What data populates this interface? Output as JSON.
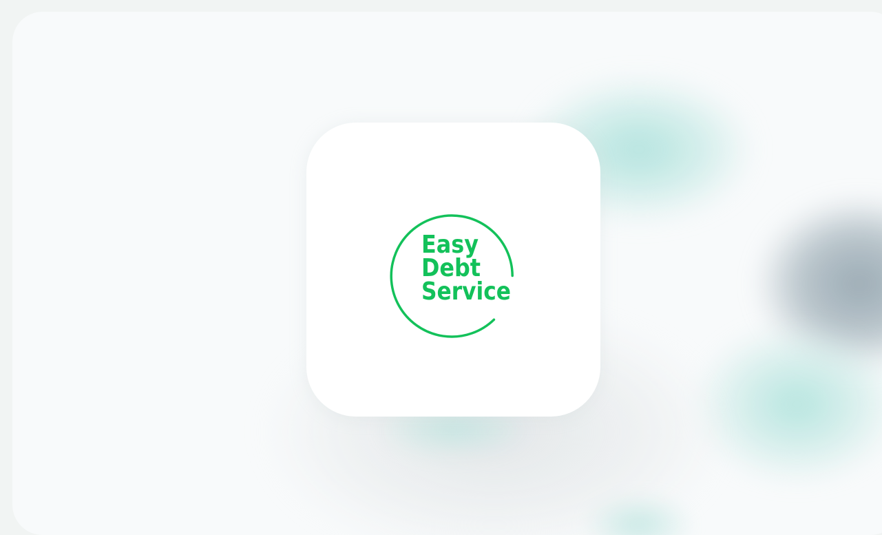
{
  "brand": {
    "name_line1": "Easy",
    "name_line2": "Debt",
    "name_line3": "Service",
    "color": "#13c15a"
  },
  "colors": {
    "background": "#f1f4f3",
    "panel": "#f8fafb",
    "card": "#ffffff"
  },
  "icons": [
    "logo-ring-icon"
  ]
}
